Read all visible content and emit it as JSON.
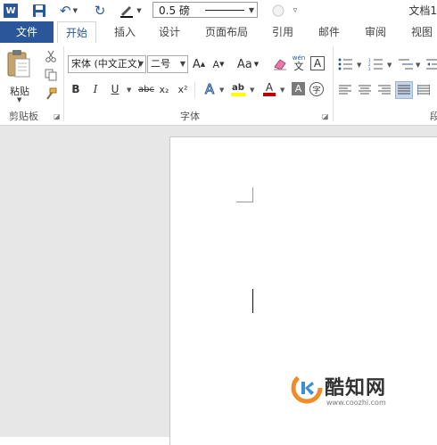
{
  "qat": {
    "logo_letter": "W",
    "line_weight": "0.5 磅",
    "doc_title": "文档1"
  },
  "tabs": [
    "文件",
    "开始",
    "插入",
    "设计",
    "页面布局",
    "引用",
    "邮件",
    "审阅",
    "视图"
  ],
  "active_tab": "开始",
  "clipboard": {
    "paste_label": "粘贴",
    "group_label": "剪贴板"
  },
  "font": {
    "font_name": "宋体 (中文正文)",
    "font_size": "二号",
    "group_label": "字体",
    "aa_label": "Aa",
    "wen_label": "文",
    "wen_top": "wén",
    "char_border": "A",
    "grow": "A",
    "shrink": "A",
    "bold": "B",
    "italic": "I",
    "underline": "U",
    "strike": "abc",
    "sub": "x₂",
    "sup": "x²",
    "effects": "A",
    "highlight": "ab",
    "color": "A",
    "shade": "A",
    "enclose": "字"
  },
  "paragraph": {
    "group_label_partial": "段"
  },
  "watermark": {
    "name": "酷知网",
    "url": "www.coozhi.com"
  },
  "colors": {
    "brand": "#2b579a",
    "font_color_bar": "#c00000",
    "highlight_bar": "#ffff00",
    "watermark_orange": "#f08c28",
    "watermark_blue": "#3a8fd6"
  }
}
